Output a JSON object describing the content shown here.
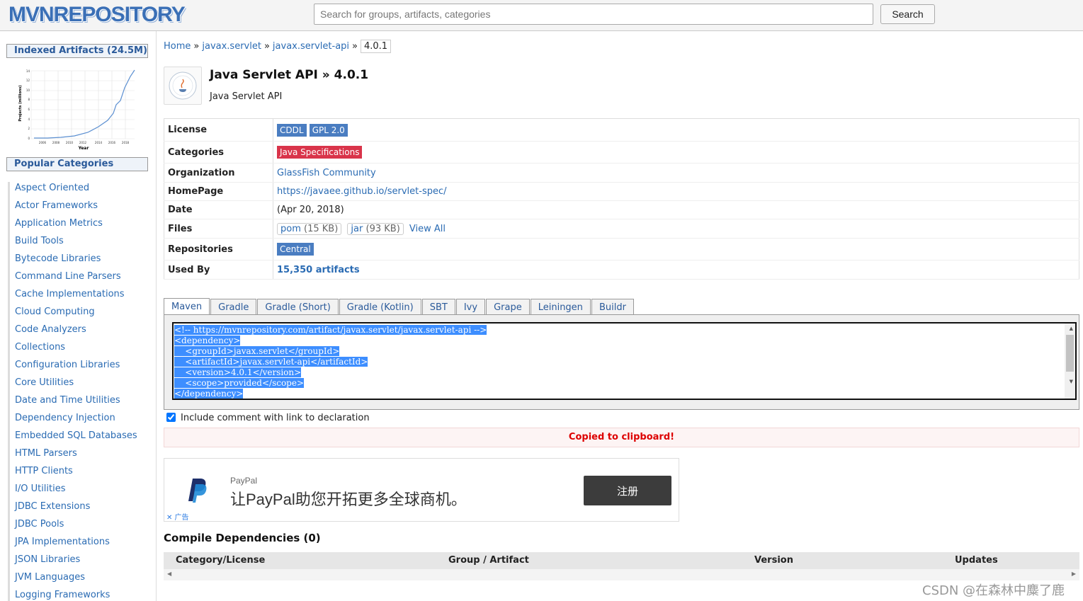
{
  "header": {
    "logo_text": "MVNREPOSITORY",
    "search_placeholder": "Search for groups, artifacts, categories",
    "search_button": "Search"
  },
  "sidebar": {
    "indexed_label": "Indexed Artifacts (24.5M)",
    "popular_label": "Popular Categories",
    "chart": {
      "ylabel": "Projects (millions)",
      "xlabel": "Year",
      "y_ticks": [
        "0",
        "2",
        "4",
        "6",
        "8",
        "10",
        "12",
        "14"
      ],
      "x_ticks": [
        "2006",
        "2008",
        "2010",
        "2012",
        "2014",
        "2016",
        "2018"
      ]
    },
    "categories": [
      "Aspect Oriented",
      "Actor Frameworks",
      "Application Metrics",
      "Build Tools",
      "Bytecode Libraries",
      "Command Line Parsers",
      "Cache Implementations",
      "Cloud Computing",
      "Code Analyzers",
      "Collections",
      "Configuration Libraries",
      "Core Utilities",
      "Date and Time Utilities",
      "Dependency Injection",
      "Embedded SQL Databases",
      "HTML Parsers",
      "HTTP Clients",
      "I/O Utilities",
      "JDBC Extensions",
      "JDBC Pools",
      "JPA Implementations",
      "JSON Libraries",
      "JVM Languages",
      "Logging Frameworks"
    ]
  },
  "breadcrumb": {
    "home": "Home",
    "group": "javax.servlet",
    "artifact": "javax.servlet-api",
    "version": "4.0.1",
    "sep": "»"
  },
  "artifact": {
    "title": "Java Servlet API » 4.0.1",
    "subtitle": "Java Servlet API"
  },
  "info": {
    "license_label": "License",
    "licenses": [
      "CDDL",
      "GPL 2.0"
    ],
    "categories_label": "Categories",
    "category": "Java Specifications",
    "organization_label": "Organization",
    "organization": "GlassFish Community",
    "homepage_label": "HomePage",
    "homepage": "https://javaee.github.io/servlet-spec/",
    "date_label": "Date",
    "date": "(Apr 20, 2018)",
    "files_label": "Files",
    "file_pom": "pom",
    "file_pom_size": "(15 KB)",
    "file_jar": "jar",
    "file_jar_size": "(93 KB)",
    "view_all": "View All",
    "repositories_label": "Repositories",
    "repository": "Central",
    "used_by_label": "Used By",
    "used_by": "15,350 artifacts"
  },
  "tabs": [
    "Maven",
    "Gradle",
    "Gradle (Short)",
    "Gradle (Kotlin)",
    "SBT",
    "Ivy",
    "Grape",
    "Leiningen",
    "Buildr"
  ],
  "code_lines": [
    "<!-- https://mvnrepository.com/artifact/javax.servlet/javax.servlet-api -->",
    "<dependency>",
    "    <groupId>javax.servlet</groupId>",
    "    <artifactId>javax.servlet-api</artifactId>",
    "    <version>4.0.1</version>",
    "    <scope>provided</scope>",
    "</dependency>"
  ],
  "include_comment_label": "Include comment with link to declaration",
  "include_comment_checked": true,
  "copied_message": "Copied to clipboard!",
  "ad": {
    "brand": "PayPal",
    "text": "让PayPal助您开拓更多全球商机。",
    "button": "注册",
    "tag": "✕ 广告"
  },
  "dependencies": {
    "title": "Compile Dependencies (0)",
    "columns": [
      "Category/License",
      "Group / Artifact",
      "Version",
      "Updates"
    ]
  },
  "watermark": "CSDN @在森林中麋了鹿",
  "colors": {
    "link": "#2a6bb3",
    "badge_blue": "#4a7dc1",
    "badge_red": "#d9344a",
    "selection": "#3d8eff",
    "copied_red": "#dd0000"
  }
}
